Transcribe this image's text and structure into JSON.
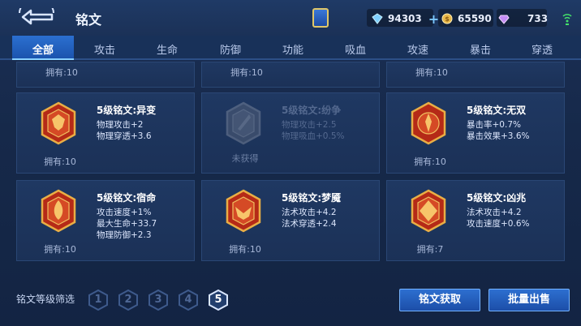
{
  "header": {
    "title": "铭文",
    "currencies": {
      "diamond": "94303",
      "gold": "65590",
      "gem": "733"
    }
  },
  "tabs": [
    "全部",
    "攻击",
    "生命",
    "防御",
    "功能",
    "吸血",
    "攻速",
    "暴击",
    "穿透"
  ],
  "active_tab": "全部",
  "top_row_owned": [
    "拥有:10",
    "拥有:10",
    "拥有:10"
  ],
  "cards": [
    {
      "name": "5级铭文:异变",
      "stats": [
        "物理攻击+2",
        "物理穿透+3.6"
      ],
      "owned": "拥有:10",
      "obtained": true
    },
    {
      "name": "5级铭文:纷争",
      "stats": [
        "物理攻击+2.5",
        "物理吸血+0.5%"
      ],
      "owned": "未获得",
      "obtained": false
    },
    {
      "name": "5级铭文:无双",
      "stats": [
        "暴击率+0.7%",
        "暴击效果+3.6%"
      ],
      "owned": "拥有:10",
      "obtained": true
    },
    {
      "name": "5级铭文:宿命",
      "stats": [
        "攻击速度+1%",
        "最大生命+33.7",
        "物理防御+2.3"
      ],
      "owned": "拥有:10",
      "obtained": true
    },
    {
      "name": "5级铭文:梦魇",
      "stats": [
        "法术攻击+4.2",
        "法术穿透+2.4"
      ],
      "owned": "拥有:10",
      "obtained": true
    },
    {
      "name": "5级铭文:凶兆",
      "stats": [
        "法术攻击+4.2",
        "攻击速度+0.6%"
      ],
      "owned": "拥有:7",
      "obtained": true
    }
  ],
  "footer": {
    "filter_label": "铭文等级筛选",
    "levels": [
      "1",
      "2",
      "3",
      "4",
      "5"
    ],
    "selected_level": "5",
    "get_button": "铭文获取",
    "sell_button": "批量出售"
  },
  "colors": {
    "accent": "#2d6fd0",
    "emblem_red": "#c8341f",
    "emblem_gold": "#e7a93a"
  }
}
